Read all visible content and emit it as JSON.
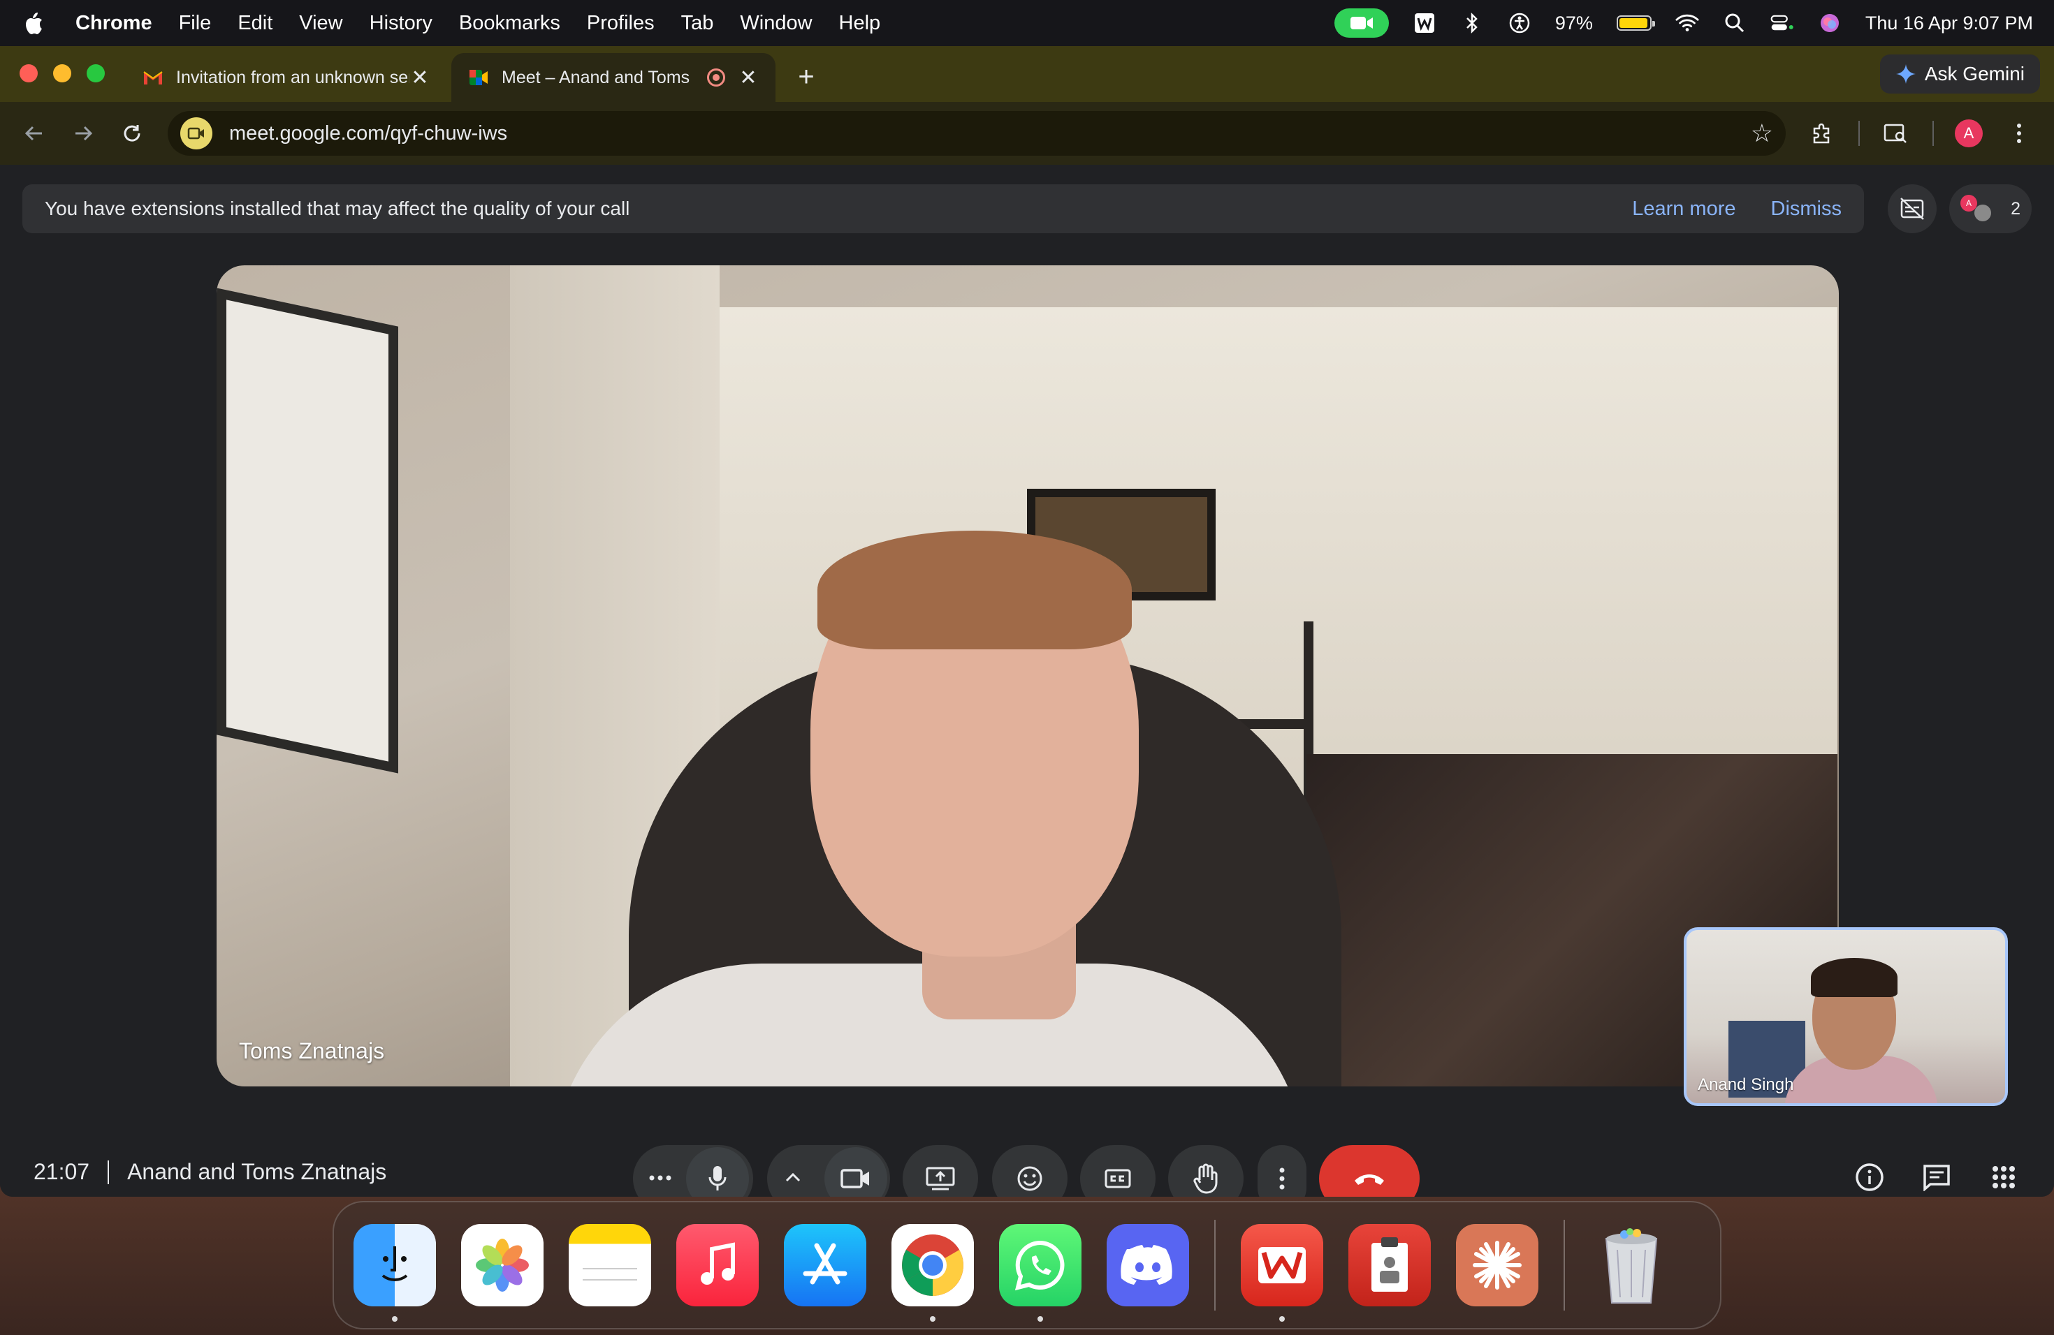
{
  "menubar": {
    "app_name": "Chrome",
    "menus": [
      "File",
      "Edit",
      "View",
      "History",
      "Bookmarks",
      "Profiles",
      "Tab",
      "Window",
      "Help"
    ],
    "battery": "97%",
    "datetime": "Thu 16 Apr  9:07 PM",
    "icons": [
      "apple-icon",
      "facetime-camera-icon",
      "wps-icon",
      "bluetooth-icon",
      "accessibility-icon",
      "battery-icon",
      "wifi-icon",
      "spotlight-search-icon",
      "control-center-icon",
      "siri-icon"
    ]
  },
  "tabs": [
    {
      "title": "Invitation from an unknown sender",
      "favicon": "gmail-icon"
    },
    {
      "title": "Meet – Anand and Toms Znatnajs",
      "favicon": "google-meet-icon"
    }
  ],
  "gemini": {
    "label": "Ask Gemini"
  },
  "omnibox": {
    "url": "meet.google.com/qyf-chuw-iws"
  },
  "profile": {
    "initial": "A",
    "color": "#e8375f"
  },
  "banner": {
    "message": "You have extensions installed that may affect the quality of your call",
    "learn_more": "Learn more",
    "dismiss": "Dismiss"
  },
  "participants": {
    "count": "2"
  },
  "main_video": {
    "name": "Toms Znatnajs"
  },
  "self_view": {
    "name": "Anand Singh"
  },
  "call": {
    "time": "21:07",
    "meeting_name": "Anand and Toms Znatnajs"
  },
  "dock": {
    "apps": [
      "Finder",
      "Photos",
      "Notes",
      "Music",
      "App Store",
      "Google Chrome",
      "WhatsApp",
      "Discord",
      "WPS Office",
      "Preview",
      "Claude",
      "Trash"
    ]
  },
  "colors": {
    "hangup": "#dc362e",
    "link": "#8ab4f8",
    "self_view_border": "#a8c7fa",
    "tab_strip": "#3d3a12"
  }
}
